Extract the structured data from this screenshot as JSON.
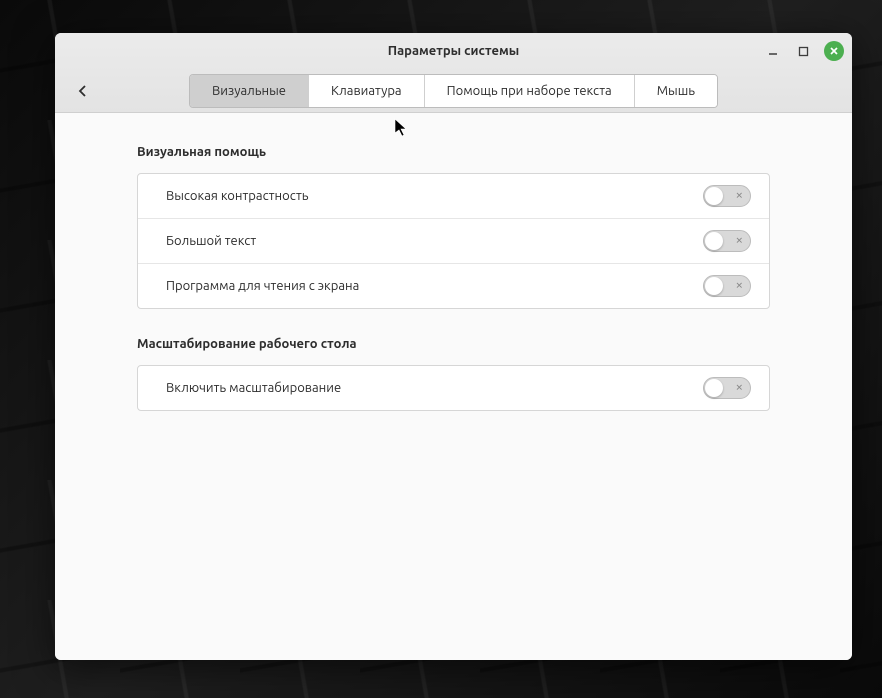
{
  "window": {
    "title": "Параметры системы"
  },
  "tabs": [
    {
      "label": "Визуальные",
      "active": true
    },
    {
      "label": "Клавиатура",
      "active": false
    },
    {
      "label": "Помощь при наборе текста",
      "active": false
    },
    {
      "label": "Мышь",
      "active": false
    }
  ],
  "sections": {
    "visual": {
      "header": "Визуальная помощь",
      "rows": [
        {
          "label": "Высокая контрастность",
          "on": false
        },
        {
          "label": "Большой текст",
          "on": false
        },
        {
          "label": "Программа для чтения с экрана",
          "on": false
        }
      ]
    },
    "scaling": {
      "header": "Масштабирование рабочего стола",
      "rows": [
        {
          "label": "Включить масштабирование",
          "on": false
        }
      ]
    }
  }
}
